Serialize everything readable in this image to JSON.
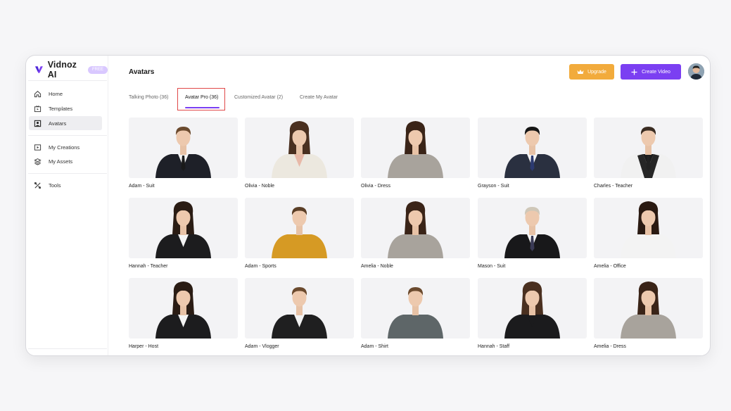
{
  "brand": {
    "name": "Vidnoz AI",
    "badge": "FREE"
  },
  "sidebar": {
    "items": [
      {
        "label": "Home",
        "icon": "home-icon"
      },
      {
        "label": "Templates",
        "icon": "templates-icon"
      },
      {
        "label": "Avatars",
        "icon": "avatar-icon",
        "active": true
      },
      {
        "label": "My Creations",
        "icon": "play-icon"
      },
      {
        "label": "My Assets",
        "icon": "layers-icon"
      },
      {
        "label": "Tools",
        "icon": "tools-icon"
      }
    ]
  },
  "header": {
    "title": "Avatars",
    "upgrade_label": "Upgrade",
    "create_label": "Create Video"
  },
  "tabs": [
    {
      "label": "Talking Photo (36)"
    },
    {
      "label": "Avatar Pro (36)",
      "active": true
    },
    {
      "label": "Customized Avatar (2)"
    },
    {
      "label": "Create My Avatar"
    }
  ],
  "colors": {
    "accent": "#7b3ff2",
    "upgrade": "#f2ab3c",
    "highlight": "#e04848"
  },
  "avatars": [
    {
      "name": "Adam - Suit",
      "outfit": "dark-suit"
    },
    {
      "name": "Olivia - Noble",
      "outfit": "white-blazer"
    },
    {
      "name": "Olivia - Dress",
      "outfit": "grey-dress"
    },
    {
      "name": "Grayson - Suit",
      "outfit": "navy-suit"
    },
    {
      "name": "Charles - Teacher",
      "outfit": "vest"
    },
    {
      "name": "Hannah - Teacher",
      "outfit": "black-blazer"
    },
    {
      "name": "Adam - Sports",
      "outfit": "yellow-hoodie"
    },
    {
      "name": "Amelia - Noble",
      "outfit": "grey-dress"
    },
    {
      "name": "Mason - Suit",
      "outfit": "black-suit"
    },
    {
      "name": "Amelia - Office",
      "outfit": "white-blouse"
    },
    {
      "name": "Harper - Host",
      "outfit": "black-blazer"
    },
    {
      "name": "Adam - Vlogger",
      "outfit": "black-jacket"
    },
    {
      "name": "Adam - Shirt",
      "outfit": "grey-shirt"
    },
    {
      "name": "Hannah - Staff",
      "outfit": "black-shirt"
    },
    {
      "name": "Amelia - Dress",
      "outfit": "grey-dress"
    }
  ]
}
